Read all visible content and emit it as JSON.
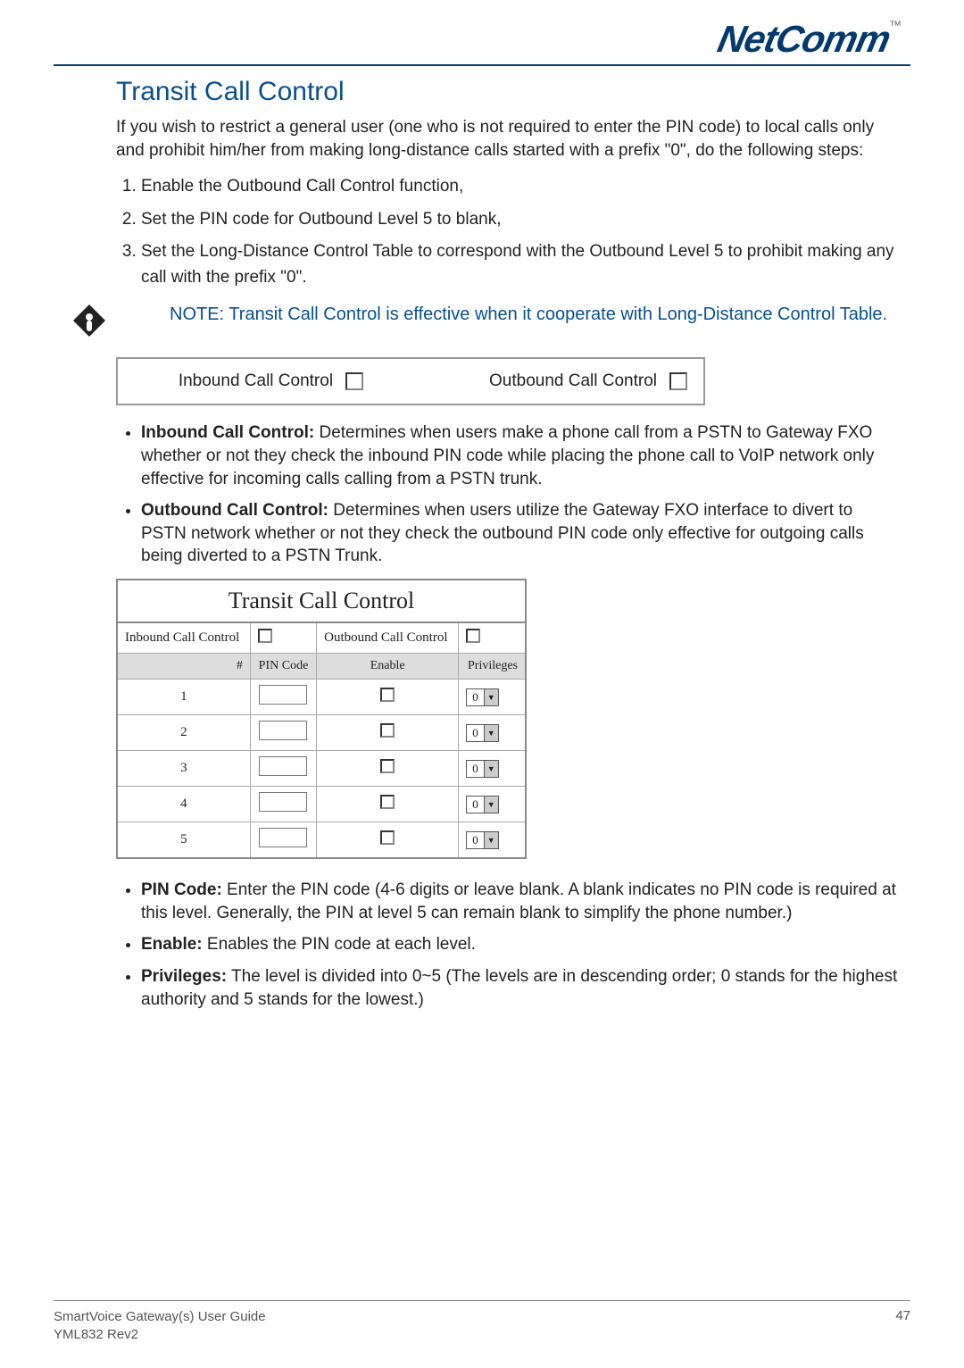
{
  "header": {
    "logo": "NetComm",
    "tm": "™"
  },
  "section": {
    "title": "Transit Call Control"
  },
  "intro": "If you wish to restrict a general user (one who is not required to enter the PIN code) to local calls only and prohibit him/her from making long-distance calls started with a prefix \"0\", do the following steps:",
  "steps": [
    "Enable the Outbound Call Control function,",
    "Set the PIN code for Outbound Level 5 to blank,",
    "Set the Long-Distance Control Table to correspond with the Outbound Level 5 to prohibit making any call with the prefix \"0\"."
  ],
  "note": "NOTE: Transit Call Control is effective when it cooperate with Long-Distance Control Table.",
  "img1": {
    "inbound_label": "Inbound Call Control",
    "outbound_label": "Outbound Call Control"
  },
  "bullets1": [
    {
      "term": "Inbound Call Control:",
      "desc": " Determines when users make a phone call from a PSTN to Gateway FXO whether or not they check the inbound PIN code while placing the phone call to VoIP network only effective for incoming calls calling from a PSTN trunk."
    },
    {
      "term": "Outbound Call Control:",
      "desc": " Determines when users utilize the Gateway FXO interface to divert to PSTN network whether or not they check the outbound PIN code only effective for outgoing calls being diverted to a PSTN Trunk."
    }
  ],
  "tcc": {
    "caption": "Transit Call Control",
    "row0": {
      "c1": "Inbound Call Control",
      "c2": "",
      "c3": "Outbound Call Control",
      "c4": ""
    },
    "headers": {
      "num": "#",
      "pin": "PIN Code",
      "enable": "Enable",
      "priv": "Privileges"
    },
    "rows": [
      {
        "n": "1",
        "priv": "0"
      },
      {
        "n": "2",
        "priv": "0"
      },
      {
        "n": "3",
        "priv": "0"
      },
      {
        "n": "4",
        "priv": "0"
      },
      {
        "n": "5",
        "priv": "0"
      }
    ]
  },
  "bullets2": [
    {
      "term": "PIN Code:",
      "desc": " Enter the PIN code (4-6 digits or leave blank. A blank indicates no PIN code is required at this level. Generally, the PIN at level 5 can remain blank to simplify the phone number.)"
    },
    {
      "term": "Enable:",
      "desc": " Enables the PIN code at each level."
    },
    {
      "term": "Privileges:",
      "desc": " The level is divided into 0~5 (The levels are in descending order; 0 stands for the highest authority and 5 stands for the lowest.)"
    }
  ],
  "footer": {
    "line1": "SmartVoice Gateway(s) User Guide",
    "line2": "YML832 Rev2",
    "page": "47"
  }
}
